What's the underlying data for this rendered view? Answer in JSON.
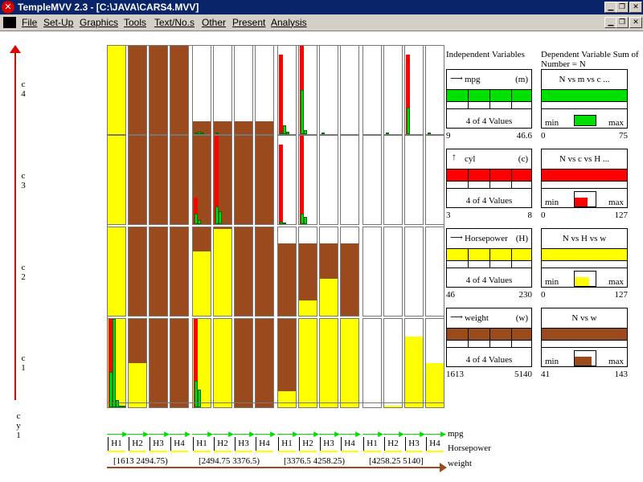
{
  "window": {
    "title": "TempleMVV 2.3 - [C:\\JAVA\\CARS4.MVV]"
  },
  "menu": [
    "File",
    "Set-Up",
    "Graphics",
    "Tools",
    "Text/No.s",
    "Other",
    "Present",
    "Analysis"
  ],
  "outer_axis": {
    "labels": [
      "c 4",
      "c 3",
      "c 2",
      "c 1"
    ],
    "name": "c y 1"
  },
  "panel": {
    "independent_title": "Independent Variables",
    "dependent_title": "Dependent Variable Sum of Number = N",
    "variables": [
      {
        "name": "mpg",
        "code": "(m)",
        "color": "#00e000",
        "values_text": "4 of 4 Values",
        "min": "9",
        "max": "46.6",
        "dep_label": "N vs m vs c ...",
        "dep_min": "min",
        "dep_max": "max",
        "dep_low": "0",
        "dep_high": "75",
        "dep_fill": 1.0
      },
      {
        "name": "cyl",
        "code": "(c)",
        "color": "#ff0000",
        "values_text": "4 of 4 Values",
        "min": "3",
        "max": "8",
        "dep_label": "N vs c vs H ...",
        "dep_min": "min",
        "dep_max": "max",
        "dep_low": "0",
        "dep_high": "127",
        "dep_fill": 0.6
      },
      {
        "name": "Horsepower",
        "code": "(H)",
        "color": "#ffff00",
        "values_text": "4 of 4 Values",
        "min": "46",
        "max": "230",
        "dep_label": "N vs H vs w",
        "dep_min": "min",
        "dep_max": "max",
        "dep_low": "0",
        "dep_high": "127",
        "dep_fill": 0.7
      },
      {
        "name": "weight",
        "code": "(w)",
        "color": "#9b4a1e",
        "values_text": "4 of 4 Values",
        "min": "1613",
        "max": "5140",
        "dep_label": "N vs w",
        "dep_min": "min",
        "dep_max": "max",
        "dep_low": "41",
        "dep_high": "143",
        "dep_fill": 0.8
      }
    ]
  },
  "bottom_axes": {
    "mpg_label": "mpg",
    "horsepower_label": "Horsepower",
    "weight_label": "weight",
    "h_labels": [
      "H1",
      "H2",
      "H3",
      "H4"
    ],
    "weight_ranges": [
      "[1613 2494.75)",
      "[2494.75 3376.5)",
      "[3376.5 4258.25)",
      "[4258.25 5140]"
    ]
  },
  "colors": {
    "brown": "#9b4a1e",
    "yellow": "#ffff00",
    "red": "#ff0000",
    "green": "#00e000",
    "titlebar": "#0a246a"
  },
  "grid_data": {
    "rows": [
      "c4",
      "c3",
      "c2",
      "c1"
    ],
    "weight_groups": 4,
    "horsepower_levels": 4,
    "cells": [
      [
        [
          {
            "y": 1.0
          },
          {
            "b": 1.0
          },
          {
            "b": 1.0
          },
          {
            "b": 1.0
          }
        ],
        [
          {
            "b": 0.15,
            "g": [
              0.01,
              0.03,
              0.02
            ]
          },
          {
            "b": 0.15,
            "g": [
              0.02
            ]
          },
          {
            "b": 0.15
          },
          {
            "b": 0.15
          }
        ],
        [
          {
            "r": [
              0.9
            ],
            "g": [
              0.02,
              0.1,
              0.03
            ]
          },
          {
            "r": [
              1.0
            ],
            "g": [
              0.5,
              0.05
            ]
          },
          {
            "g": [
              0.02
            ]
          },
          {}
        ],
        [
          {},
          {
            "g": [
              0.02
            ]
          },
          {
            "r": [
              0.9
            ],
            "g": [
              0.3
            ]
          },
          {
            "g": [
              0.02
            ]
          }
        ]
      ],
      [
        [
          {
            "y": 1.0
          },
          {
            "b": 1.0
          },
          {
            "b": 1.0
          },
          {
            "b": 1.0
          }
        ],
        [
          {
            "b": 1.0,
            "r": [
              0.3
            ],
            "g": [
              0.12,
              0.05
            ]
          },
          {
            "b": 1.0,
            "r": [
              1.0
            ],
            "g": [
              0.2,
              0.15
            ]
          },
          {
            "b": 1.0
          },
          {
            "b": 1.0
          }
        ],
        [
          {
            "r": [
              0.9
            ],
            "g": [
              0.03,
              0.01
            ]
          },
          {
            "r": [
              1.0
            ],
            "g": [
              0.12,
              0.08
            ]
          },
          {},
          {}
        ],
        [
          {},
          {},
          {},
          {}
        ]
      ],
      [
        [
          {
            "y": 1.0
          },
          {
            "b": 1.0
          },
          {
            "b": 1.0
          },
          {
            "b": 1.0
          }
        ],
        [
          {
            "b": 1.0,
            "y": 0.73
          },
          {
            "b": 1.0,
            "y": 0.98
          },
          {
            "b": 1.0
          },
          {
            "b": 1.0
          }
        ],
        [
          {
            "b": 0.82
          },
          {
            "b": 0.82,
            "y": 0.17
          },
          {
            "b": 0.82,
            "y": 0.42
          },
          {
            "b": 0.82
          }
        ],
        [
          {},
          {},
          {},
          {}
        ]
      ],
      [
        [
          {
            "y": 1.0,
            "r": [
              1.0
            ],
            "g": [
              0.4,
              1.0,
              0.08,
              0.02,
              0.02
            ]
          },
          {
            "y": 0.5,
            "b": 1.0
          },
          {
            "b": 1.0
          },
          {
            "b": 1.0
          }
        ],
        [
          {
            "y": 1.0,
            "r": [
              1.0
            ],
            "g": [
              0.3,
              0.2
            ]
          },
          {
            "y": 1.0,
            "b": 1.0
          },
          {
            "b": 1.0
          },
          {
            "b": 1.0
          }
        ],
        [
          {
            "b": 1.0,
            "y": 0.18
          },
          {
            "b": 1.0,
            "y": 1.0
          },
          {
            "b": 1.0,
            "y": 1.0
          },
          {
            "b": 1.0,
            "y": 1.0
          }
        ],
        [
          {},
          {
            "y": 0.02
          },
          {
            "y": 0.8
          },
          {
            "y": 0.5
          }
        ]
      ]
    ]
  }
}
